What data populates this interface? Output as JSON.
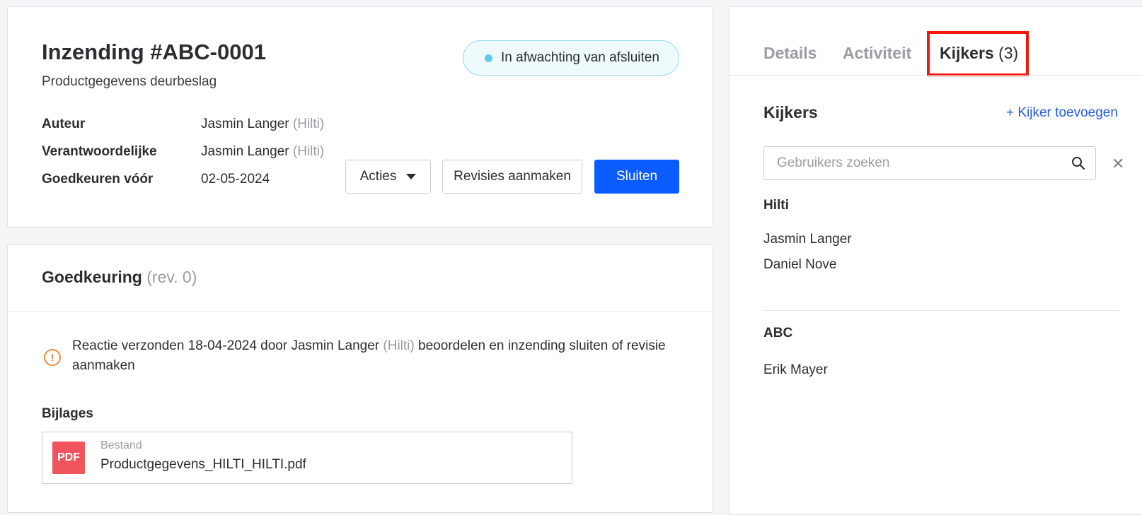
{
  "submission": {
    "title": "Inzending #ABC-0001",
    "subtitle": "Productgegevens deurbeslag",
    "status": "In afwachting van afsluiten",
    "meta": {
      "author_label": "Auteur",
      "author_name": "Jasmin Langer",
      "author_org": "(Hilti)",
      "responsible_label": "Verantwoordelijke",
      "responsible_name": "Jasmin Langer",
      "responsible_org": "(Hilti)",
      "approve_label": "Goedkeuren vóór",
      "approve_date": "02-05-2024"
    },
    "actions_label": "Acties",
    "revisions_label": "Revisies aanmaken",
    "close_label": "Sluiten"
  },
  "approval": {
    "heading": "Goedkeuring",
    "revision": "(rev. 0)",
    "alert_icon": "!",
    "alert_part1": "Reactie verzonden 18-04-2024 door Jasmin Langer",
    "alert_org": "(Hilti)",
    "alert_part2": "beoordelen en inzending sluiten of revisie aanmaken",
    "attachments_label": "Bijlages",
    "file_type": "PDF",
    "file_caption": "Bestand",
    "file_name": "Productgegevens_HILTI_HILTI.pdf"
  },
  "side": {
    "tabs": [
      {
        "label": "Details"
      },
      {
        "label": "Activiteit"
      },
      {
        "label": "Kijkers",
        "count": "(3)"
      }
    ],
    "heading": "Kijkers",
    "add_link": "+ Kijker toevoegen",
    "search_placeholder": "Gebruikers zoeken",
    "clear_icon": "✕",
    "groups": [
      {
        "name": "Hilti",
        "members": [
          "Jasmin Langer",
          "Daniel Nove"
        ]
      },
      {
        "name": "ABC",
        "members": [
          "Erik Mayer"
        ]
      }
    ]
  },
  "colors": {
    "primary": "#0a5cff",
    "link": "#1f5be6",
    "status_dot": "#5fc9ee",
    "alert": "#f08a3c",
    "pdf": "#f0555d",
    "highlight": "#f2180c"
  }
}
